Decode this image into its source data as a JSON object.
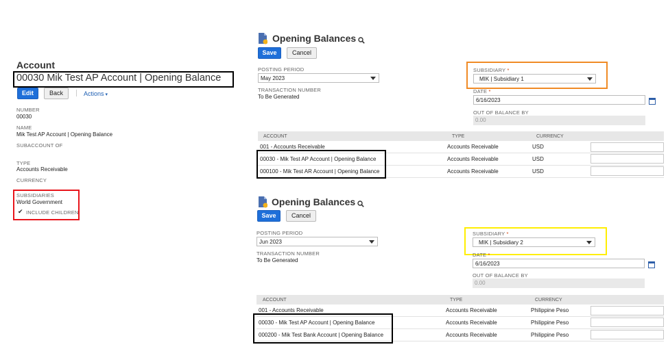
{
  "account": {
    "heading": "Account",
    "record_title": "00030 Mik Test AP Account | Opening Balance",
    "edit_label": "Edit",
    "back_label": "Back",
    "actions_label": "Actions",
    "number_label": "NUMBER",
    "number_value": "00030",
    "name_label": "NAME",
    "name_value": "Mik Test AP Account | Opening Balance",
    "subaccount_label": "SUBACCOUNT OF",
    "type_label": "TYPE",
    "type_value": "Accounts Receivable",
    "currency_label": "CURRENCY",
    "subsidiaries_label": "SUBSIDIARIES",
    "subsidiaries_value": "World Government",
    "include_children_label": "INCLUDE CHILDREN"
  },
  "forms": [
    {
      "title": "Opening Balances",
      "save_label": "Save",
      "cancel_label": "Cancel",
      "posting_period_label": "POSTING PERIOD",
      "posting_period_value": "May 2023",
      "transaction_number_label": "TRANSACTION NUMBER",
      "transaction_number_value": "To Be Generated",
      "subsidiary_label": "SUBSIDIARY",
      "subsidiary_value": "MIK | Subsidiary 1",
      "date_label": "DATE",
      "date_value": "6/16/2023",
      "out_of_balance_label": "OUT OF BALANCE BY",
      "out_of_balance_value": "0.00",
      "columns": [
        "ACCOUNT",
        "TYPE",
        "CURRENCY"
      ],
      "rows": [
        {
          "account": "001 - Accounts Receivable",
          "type": "Accounts Receivable",
          "currency": "USD"
        },
        {
          "account": "00030 - Mik Test AP Account | Opening Balance",
          "type": "Accounts Receivable",
          "currency": "USD"
        },
        {
          "account": "000100 - Mik Test AR Account | Opening Balance",
          "type": "Accounts Receivable",
          "currency": "USD"
        }
      ]
    },
    {
      "title": "Opening Balances",
      "save_label": "Save",
      "cancel_label": "Cancel",
      "posting_period_label": "POSTING PERIOD",
      "posting_period_value": "Jun 2023",
      "transaction_number_label": "TRANSACTION NUMBER",
      "transaction_number_value": "To Be Generated",
      "subsidiary_label": "SUBSIDIARY",
      "subsidiary_value": "MIK | Subsidiary 2",
      "date_label": "DATE",
      "date_value": "6/16/2023",
      "out_of_balance_label": "OUT OF BALANCE BY",
      "out_of_balance_value": "0.00",
      "columns": [
        "ACCOUNT",
        "TYPE",
        "CURRENCY"
      ],
      "rows": [
        {
          "account": "001 - Accounts Receivable",
          "type": "Accounts Receivable",
          "currency": "Philippine Peso"
        },
        {
          "account": "00030 - Mik Test AP Account | Opening Balance",
          "type": "Accounts Receivable",
          "currency": "Philippine Peso"
        },
        {
          "account": "000200 - Mik Test Bank Account | Opening Balance",
          "type": "Accounts Receivable",
          "currency": "Philippine Peso"
        }
      ]
    }
  ],
  "colors": {
    "primary_button": "#1e6fd9",
    "highlight_orange": "#f08a24",
    "highlight_yellow": "#ffee00",
    "highlight_red": "#e8141b",
    "highlight_black": "#000000"
  }
}
